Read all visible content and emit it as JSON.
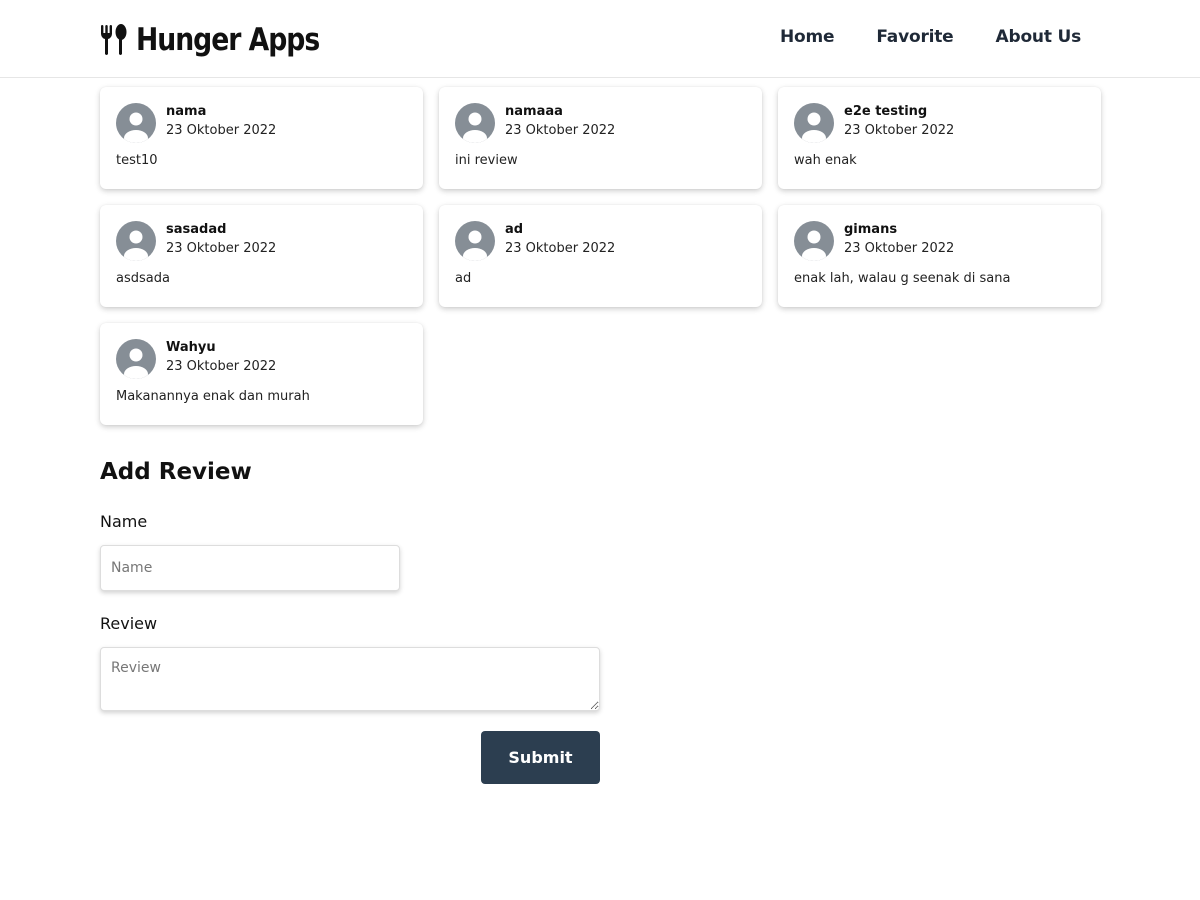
{
  "app": {
    "title": "Hunger Apps"
  },
  "nav": {
    "items": [
      {
        "label": "Home"
      },
      {
        "label": "Favorite"
      },
      {
        "label": "About Us"
      }
    ]
  },
  "reviews": [
    {
      "name": "nama",
      "date": "23 Oktober 2022",
      "text": "test10"
    },
    {
      "name": "namaaa",
      "date": "23 Oktober 2022",
      "text": "ini review"
    },
    {
      "name": "e2e testing",
      "date": "23 Oktober 2022",
      "text": "wah enak"
    },
    {
      "name": "sasadad",
      "date": "23 Oktober 2022",
      "text": "asdsada"
    },
    {
      "name": "ad",
      "date": "23 Oktober 2022",
      "text": "ad"
    },
    {
      "name": "gimans",
      "date": "23 Oktober 2022",
      "text": "enak lah, walau g seenak di sana"
    },
    {
      "name": "Wahyu",
      "date": "23 Oktober 2022",
      "text": "Makanannya enak dan murah"
    }
  ],
  "form": {
    "title": "Add Review",
    "name_label": "Name",
    "name_placeholder": "Name",
    "name_value": "",
    "review_label": "Review",
    "review_placeholder": "Review",
    "review_value": "",
    "submit_label": "Submit"
  },
  "colors": {
    "button_bg": "#2c3e50",
    "avatar": "#868e96"
  },
  "icons": {
    "brand": "fork-spoon-icon",
    "avatar": "user-avatar-icon"
  }
}
